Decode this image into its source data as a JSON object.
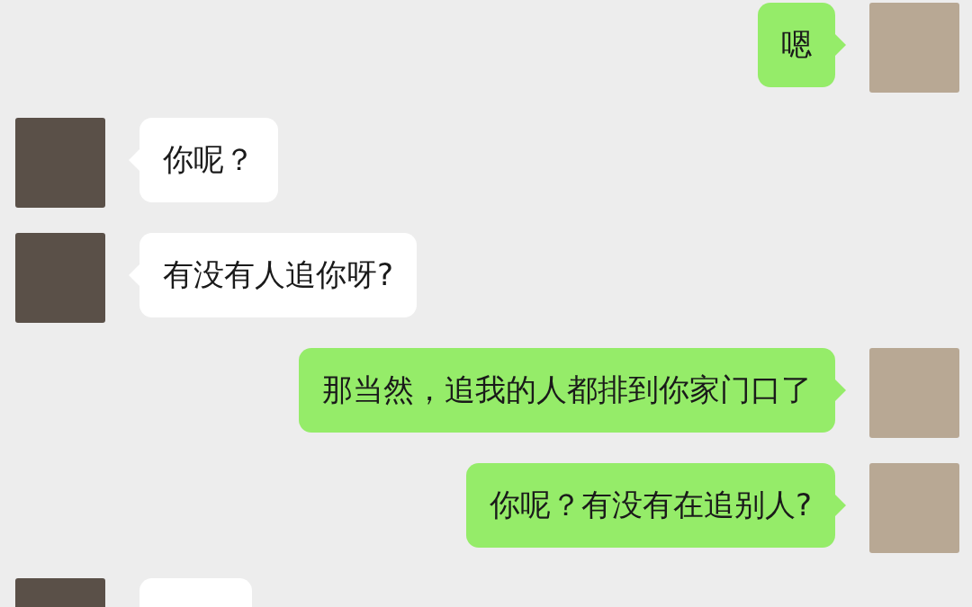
{
  "messages": [
    {
      "kind": "outgoing",
      "text": "嗯"
    },
    {
      "kind": "incoming",
      "text": "你呢？"
    },
    {
      "kind": "incoming",
      "text": "有没有人追你呀?"
    },
    {
      "kind": "outgoing",
      "text": "那当然，追我的人都排到你家门口了"
    },
    {
      "kind": "outgoing",
      "text": "你呢？有没有在追别人?"
    },
    {
      "kind": "incoming"
    }
  ]
}
